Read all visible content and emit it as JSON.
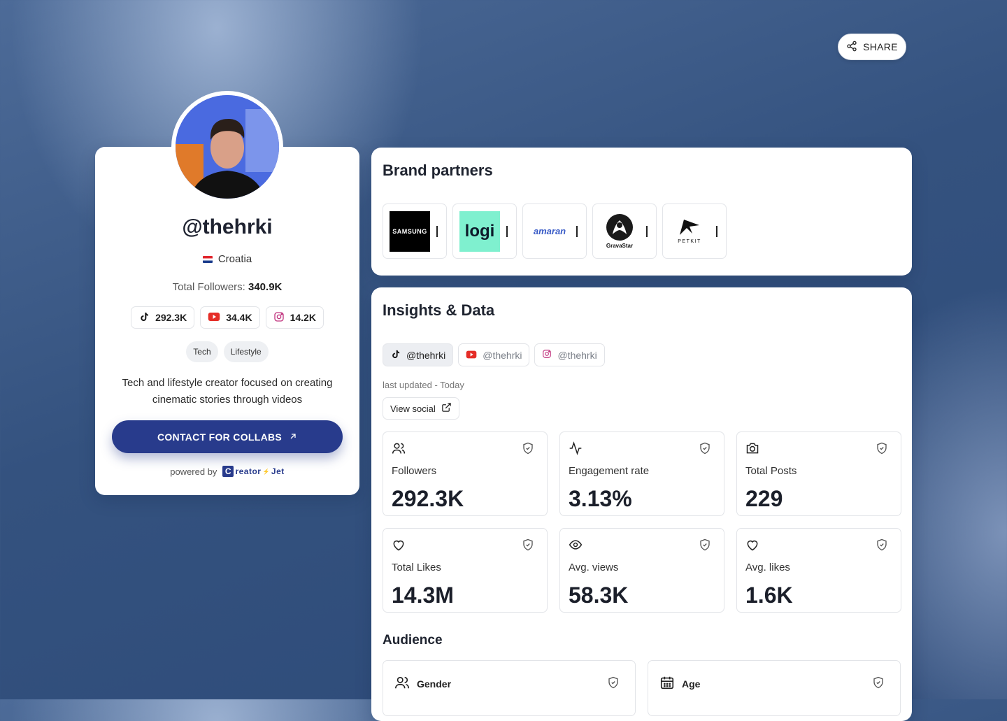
{
  "share": {
    "label": "SHARE"
  },
  "profile": {
    "handle": "@thehrki",
    "country": "Croatia",
    "followers_label": "Total Followers:",
    "followers_value": "340.9K",
    "platforms": [
      {
        "icon": "tiktok-icon",
        "count": "292.3K"
      },
      {
        "icon": "youtube-icon",
        "count": "34.4K"
      },
      {
        "icon": "instagram-icon",
        "count": "14.2K"
      }
    ],
    "tags": [
      "Tech",
      "Lifestyle"
    ],
    "bio": "Tech and lifestyle creator focused on creating cinematic stories through videos",
    "contact_label": "CONTACT FOR COLLABS",
    "powered_by": "powered by",
    "powered_brand": "reator",
    "powered_brand_suffix": "Jet",
    "powered_brand_letter": "C"
  },
  "brand_partners": {
    "title": "Brand partners",
    "brands": [
      {
        "name": "SAMSUNG"
      },
      {
        "name": "logi"
      },
      {
        "name": "amaran"
      },
      {
        "name": "GravaStar"
      },
      {
        "name": "PETKIT"
      }
    ]
  },
  "insights": {
    "title": "Insights & Data",
    "tabs": [
      {
        "icon": "tiktok-icon",
        "label": "@thehrki",
        "active": true
      },
      {
        "icon": "youtube-icon",
        "label": "@thehrki",
        "active": false
      },
      {
        "icon": "instagram-icon",
        "label": "@thehrki",
        "active": false
      }
    ],
    "last_updated": "last updated - Today",
    "view_social": "View social",
    "stats": [
      {
        "icon": "users-icon",
        "label": "Followers",
        "value": "292.3K"
      },
      {
        "icon": "activity-icon",
        "label": "Engagement rate",
        "value": "3.13%"
      },
      {
        "icon": "camera-icon",
        "label": "Total Posts",
        "value": "229"
      },
      {
        "icon": "heart-icon",
        "label": "Total Likes",
        "value": "14.3M"
      },
      {
        "icon": "eye-icon",
        "label": "Avg. views",
        "value": "58.3K"
      },
      {
        "icon": "heart-icon",
        "label": "Avg. likes",
        "value": "1.6K"
      }
    ],
    "audience": {
      "title": "Audience",
      "cards": [
        {
          "icon": "users-icon",
          "label": "Gender"
        },
        {
          "icon": "calendar-icon",
          "label": "Age"
        }
      ]
    }
  },
  "colors": {
    "accent": "#283b8c",
    "logi_bg": "#7ff0cf",
    "amaran": "#3a5cc7"
  }
}
